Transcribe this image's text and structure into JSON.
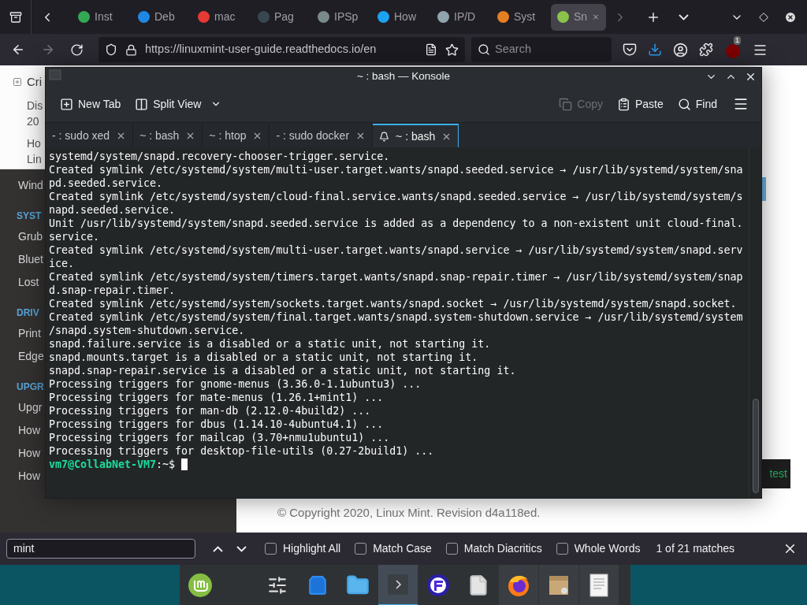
{
  "browser": {
    "tabs": [
      {
        "title": "Inst",
        "selected": false
      },
      {
        "title": "Deb",
        "selected": false
      },
      {
        "title": "mac",
        "selected": false
      },
      {
        "title": "Pag",
        "selected": false
      },
      {
        "title": "IPSp",
        "selected": false
      },
      {
        "title": "How",
        "selected": false
      },
      {
        "title": "IP/D",
        "selected": false
      },
      {
        "title": "Syst",
        "selected": false
      },
      {
        "title": "Sn",
        "selected": true
      }
    ],
    "url": "https://linuxmint-user-guide.readthedocs.io/en",
    "search_placeholder": "Search",
    "extension_badge": "1"
  },
  "page": {
    "sidebar_top": [
      {
        "lines": [
          "Cri"
        ],
        "kind": "toggle"
      },
      {
        "lines": [
          "Dis",
          "20"
        ],
        "kind": "link"
      },
      {
        "lines": [
          "Ho",
          "Lin"
        ],
        "kind": "link"
      }
    ],
    "sidebar": [
      {
        "text": "Wind",
        "kind": "link"
      },
      {
        "text": "SYST",
        "kind": "heading"
      },
      {
        "text": "Grub",
        "kind": "link"
      },
      {
        "text": "Bluet",
        "kind": "link"
      },
      {
        "text": "Lost",
        "kind": "link"
      },
      {
        "text": "DRIV",
        "kind": "heading"
      },
      {
        "text": "Print",
        "kind": "link"
      },
      {
        "text": "Edge",
        "kind": "link"
      },
      {
        "text": "UPGR",
        "kind": "heading"
      },
      {
        "text": "Upgr",
        "kind": "link"
      },
      {
        "text": "How",
        "kind": "link"
      },
      {
        "text": "How",
        "kind": "link"
      },
      {
        "text": "How",
        "kind": "link"
      }
    ],
    "button": "test",
    "copyright": "© Copyright 2020, Linux Mint. Revision d4a118ed."
  },
  "konsole": {
    "title": "~ : bash — Konsole",
    "toolbar": [
      {
        "label": "New Tab",
        "disabled": false
      },
      {
        "label": "Split View",
        "disabled": false
      },
      {
        "label": "Copy",
        "disabled": true
      },
      {
        "label": "Paste",
        "disabled": false
      },
      {
        "label": "Find",
        "disabled": false
      }
    ],
    "tabs": [
      {
        "title": "- : sudo xed",
        "selected": false,
        "bell": false
      },
      {
        "title": "~ : bash",
        "selected": false,
        "bell": false
      },
      {
        "title": "~ : htop",
        "selected": false,
        "bell": false
      },
      {
        "title": "- : sudo docker",
        "selected": false,
        "bell": false
      },
      {
        "title": "~ : bash",
        "selected": true,
        "bell": true
      }
    ],
    "lines": [
      "systemd/system/snapd.recovery-chooser-trigger.service.",
      "Created symlink /etc/systemd/system/multi-user.target.wants/snapd.seeded.service → /usr/lib/systemd/system/sna",
      "pd.seeded.service.",
      "Created symlink /etc/systemd/system/cloud-final.service.wants/snapd.seeded.service → /usr/lib/systemd/system/s",
      "napd.seeded.service.",
      "Unit /usr/lib/systemd/system/snapd.seeded.service is added as a dependency to a non-existent unit cloud-final.",
      "service.",
      "Created symlink /etc/systemd/system/multi-user.target.wants/snapd.service → /usr/lib/systemd/system/snapd.serv",
      "ice.",
      "Created symlink /etc/systemd/system/timers.target.wants/snapd.snap-repair.timer → /usr/lib/systemd/system/snap",
      "d.snap-repair.timer.",
      "Created symlink /etc/systemd/system/sockets.target.wants/snapd.socket → /usr/lib/systemd/system/snapd.socket.",
      "Created symlink /etc/systemd/system/final.target.wants/snapd.system-shutdown.service → /usr/lib/systemd/system",
      "/snapd.system-shutdown.service.",
      "snapd.failure.service is a disabled or a static unit, not starting it.",
      "snapd.mounts.target is a disabled or a static unit, not starting it.",
      "snapd.snap-repair.service is a disabled or a static unit, not starting it.",
      "Processing triggers for gnome-menus (3.36.0-1.1ubuntu3) ...",
      "Processing triggers for mate-menus (1.26.1+mint1) ...",
      "Processing triggers for man-db (2.12.0-4build2) ...",
      "Processing triggers for dbus (1.14.10-4ubuntu4.1) ...",
      "Processing triggers for mailcap (3.70+nmu1ubuntu1) ...",
      "Processing triggers for desktop-file-utils (0.27-2build1) ..."
    ],
    "prompt": {
      "user": "vm7@CollabNet-VM7",
      "path": ":~$"
    }
  },
  "find_bar": {
    "value": "mint",
    "options": [
      {
        "label": "Highlight All",
        "checked": false
      },
      {
        "label": "Match Case",
        "checked": false
      },
      {
        "label": "Match Diacritics",
        "checked": false
      },
      {
        "label": "Whole Words",
        "checked": false
      }
    ],
    "status": "1 of 21 matches"
  },
  "taskbar": [
    {
      "selected": false,
      "running": false
    },
    {
      "selected": false,
      "running": false
    },
    {
      "selected": false,
      "running": false
    },
    {
      "selected": false,
      "running": false
    },
    {
      "selected": true,
      "running": true
    },
    {
      "selected": false,
      "running": false
    },
    {
      "selected": false,
      "running": false
    },
    {
      "selected": false,
      "running": true
    },
    {
      "selected": false,
      "running": true
    },
    {
      "selected": false,
      "running": true
    }
  ]
}
